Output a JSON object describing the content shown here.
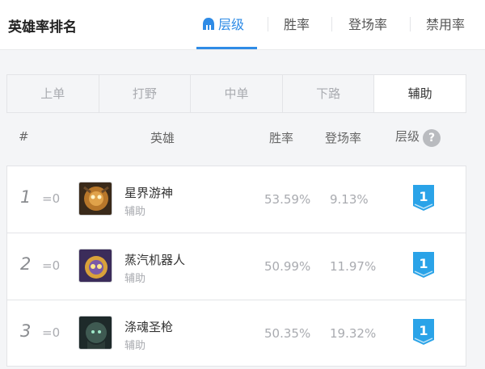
{
  "header": {
    "title": "英雄率排名",
    "tabs": [
      {
        "label": "层级",
        "active": true
      },
      {
        "label": "胜率",
        "active": false
      },
      {
        "label": "登场率",
        "active": false
      },
      {
        "label": "禁用率",
        "active": false
      }
    ]
  },
  "lanes": [
    {
      "label": "上单",
      "active": false
    },
    {
      "label": "打野",
      "active": false
    },
    {
      "label": "中单",
      "active": false
    },
    {
      "label": "下路",
      "active": false
    },
    {
      "label": "辅助",
      "active": true
    }
  ],
  "table": {
    "columns": {
      "rank": "#",
      "hero": "英雄",
      "winrate": "胜率",
      "pickrate": "登场率",
      "tier": "层级",
      "help": "?"
    },
    "rows": [
      {
        "rank": "1",
        "change": "=0",
        "name": "星界游神",
        "role": "辅助",
        "winrate": "53.59%",
        "pickrate": "9.13%",
        "tier": "1"
      },
      {
        "rank": "2",
        "change": "=0",
        "name": "蒸汽机器人",
        "role": "辅助",
        "winrate": "50.99%",
        "pickrate": "11.97%",
        "tier": "1"
      },
      {
        "rank": "3",
        "change": "=0",
        "name": "涤魂圣枪",
        "role": "辅助",
        "winrate": "50.35%",
        "pickrate": "19.32%",
        "tier": "1"
      }
    ]
  },
  "colors": {
    "accent": "#2e8be6",
    "tier_badge": "#2aa3e8"
  },
  "icons": {
    "tab_tier": "helmet-icon",
    "help": "question-circle-icon",
    "tier_badge": "tier-badge-icon"
  }
}
